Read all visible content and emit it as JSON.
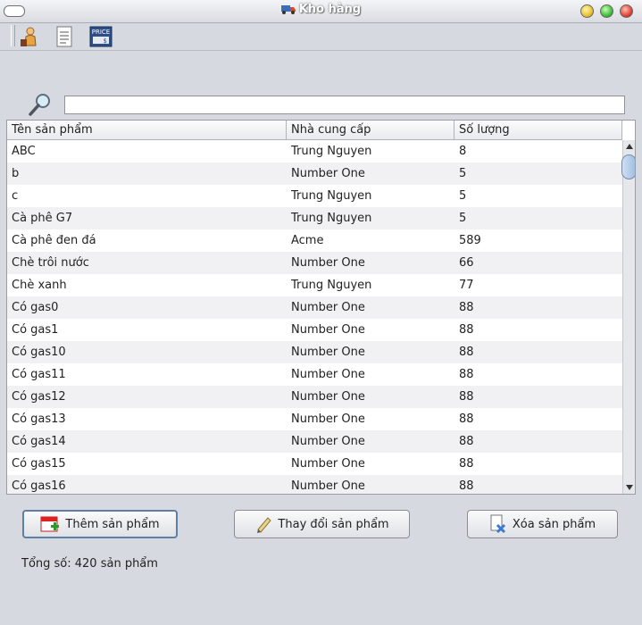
{
  "window": {
    "title": "Kho hàng"
  },
  "toolbar": {
    "items": [
      {
        "icon": "supplier-person-icon"
      },
      {
        "icon": "document-list-icon"
      },
      {
        "icon": "price-tag-icon",
        "text": "PRICE"
      }
    ]
  },
  "search": {
    "value": "",
    "placeholder": ""
  },
  "table": {
    "columns": [
      "Tên sản phẩm",
      "Nhà cung cấp",
      "Số lượng"
    ],
    "rows": [
      [
        "ABC",
        "Trung Nguyen",
        "8"
      ],
      [
        "b",
        "Number One",
        "5"
      ],
      [
        "c",
        "Trung Nguyen",
        "5"
      ],
      [
        "Cà phê G7",
        "Trung Nguyen",
        "5"
      ],
      [
        "Cà phê đen đá",
        "Acme",
        "589"
      ],
      [
        "Chè trôi nước",
        "Number One",
        "66"
      ],
      [
        "Chè xanh",
        "Trung Nguyen",
        "77"
      ],
      [
        "Có gas0",
        "Number One",
        "88"
      ],
      [
        "Có gas1",
        "Number One",
        "88"
      ],
      [
        "Có gas10",
        "Number One",
        "88"
      ],
      [
        "Có gas11",
        "Number One",
        "88"
      ],
      [
        "Có gas12",
        "Number One",
        "88"
      ],
      [
        "Có gas13",
        "Number One",
        "88"
      ],
      [
        "Có gas14",
        "Number One",
        "88"
      ],
      [
        "Có gas15",
        "Number One",
        "88"
      ],
      [
        "Có gas16",
        "Number One",
        "88"
      ]
    ]
  },
  "actions": {
    "add_label": "Thêm sản phẩm",
    "edit_label": "Thay đổi sản phẩm",
    "delete_label": "Xóa sản phẩm"
  },
  "footer": {
    "total_text": "Tổng số: 420 sản phẩm"
  },
  "colors": {
    "close": "#e0443a",
    "maximize": "#3fbf3f",
    "minimize": "#e8c23a"
  }
}
